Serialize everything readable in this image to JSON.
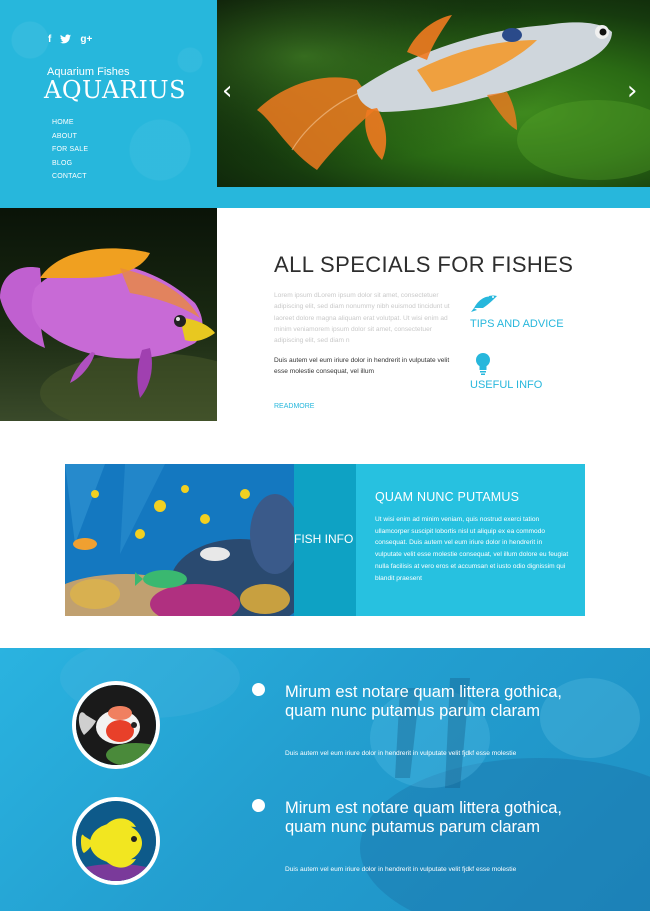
{
  "header": {
    "social": [
      {
        "label": "f",
        "icon": "facebook-icon"
      },
      {
        "label": "♦",
        "icon": "twitter-icon"
      },
      {
        "label": "g+",
        "icon": "google-plus-icon"
      }
    ],
    "tagline": "Aquarium Fishes",
    "logo": "AQUARIUS",
    "menu": [
      "HOME",
      "ABOUT",
      "FOR SALE",
      "BLOG",
      "CONTACT"
    ],
    "slider": {
      "prev_icon": "chevron-left-icon",
      "next_icon": "chevron-right-icon"
    }
  },
  "specials": {
    "title": "ALL SPECIALS FOR FISHES",
    "lorem_light": "Lorem ipsum dLorem ipsum dolor sit amet, consectetuer adipiscing elit, sed diam nonummy nibh euismod tincidunt ut laoreet dolore magna aliquam erat volutpat. Ut wisi enim ad minim veniamorem ipsum dolor sit amet, consectetuer adipiscing elit, sed diam n",
    "lorem_dark": "Duis autem vel eum iriure dolor in hendrerit in vulputate velit esse molestie consequat, vel illum",
    "readmore": "READMORE",
    "features": [
      {
        "label": "TIPS AND ADVICE",
        "icon": "fish-icon"
      },
      {
        "label": "USEFUL INFO",
        "icon": "lightbulb-icon"
      }
    ]
  },
  "fish_info": {
    "tab_label": "FISH INFO",
    "title": "QUAM NUNC PUTAMUS",
    "body": "Ut wisi enim ad minim veniam, quis nostrud exerci tation ullamcorper suscipit lobortis nisl ut aliquip ex ea commodo consequat. Duis autem vel eum iriure dolor in hendrerit in vulputate velit esse molestie consequat, vel illum dolore eu feugiat nulla facilisis at vero eros et accumsan et iusto odio dignissim qui blandit praesent"
  },
  "features_list": [
    {
      "title": "Mirum est notare quam littera gothica, quam nunc putamus parum claram",
      "text": "Duis autem vel eum iriure dolor in hendrerit in vulputate velit fjdkf esse molestie"
    },
    {
      "title": "Mirum est notare quam littera gothica, quam nunc putamus parum claram",
      "text": "Duis autem vel eum iriure dolor in hendrerit in vulputate velit fjdkf esse molestie"
    }
  ],
  "colors": {
    "accent": "#27b7dc",
    "dark_accent": "#0ea2c4",
    "panel": "#27c1e0",
    "heading": "#2e2e2e"
  }
}
